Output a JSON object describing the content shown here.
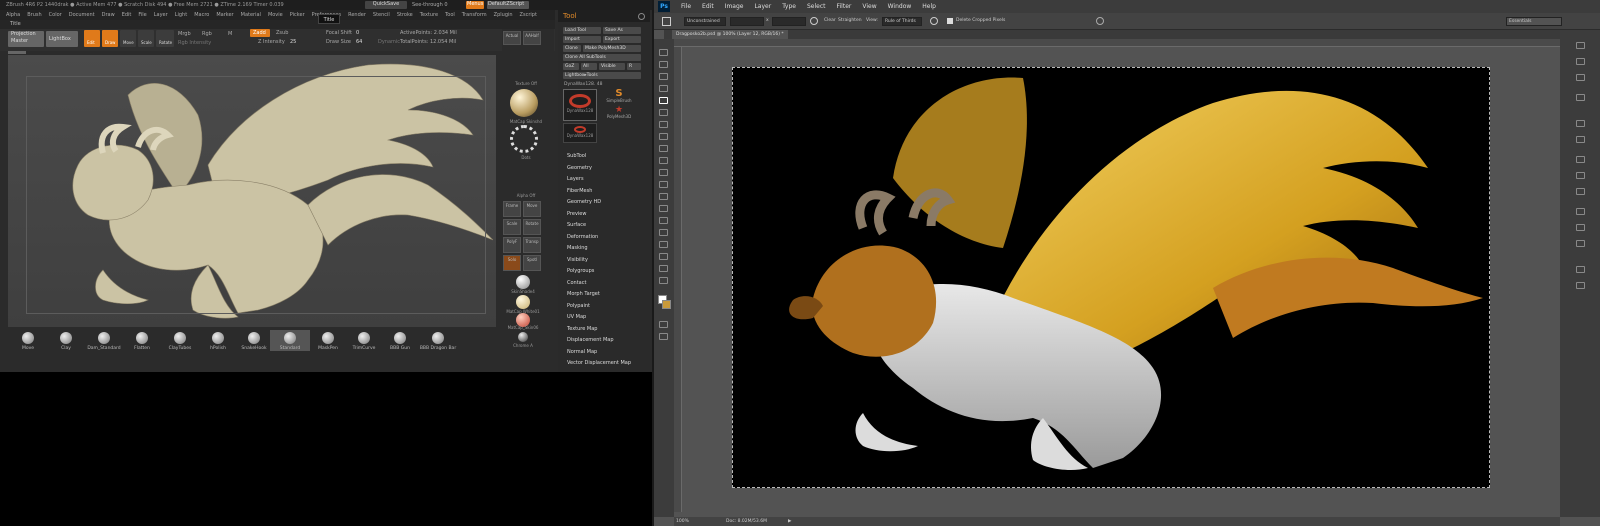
{
  "zbrush": {
    "title_bar": "ZBrush 4R6 P2   1440drak   ● Active Mem 477 ● Scratch Disk 494 ● Free Mem 2721 ● ZTime 2.169 Timer 0.039",
    "quicksave": "QuickSave",
    "see_through": "See-through 0",
    "menus_label": "Menus",
    "script_label": "DefaultZScript",
    "menu": [
      "Alpha",
      "Brush",
      "Color",
      "Document",
      "Draw",
      "Edit",
      "File",
      "Layer",
      "Light",
      "Macro",
      "Marker",
      "Material",
      "Movie",
      "Picker",
      "Preferences",
      "Render",
      "Stencil",
      "Stroke",
      "Texture",
      "Tool",
      "Transform",
      "Zplugin",
      "Zscript"
    ],
    "title_label": "Title",
    "title_tooltip": "Title",
    "shelf": {
      "projection_master": "Projection Master",
      "lightbox": "LightBox",
      "edit": "Edit",
      "draw": "Draw",
      "move": "Move",
      "scale": "Scale",
      "rotate": "Rotate",
      "mrgb": "Mrgb",
      "rgb": "Rgb",
      "m": "M",
      "rgb_intensity": "Rgb Intensity",
      "zadd": "Zadd",
      "zsub": "Zsub",
      "z_intensity_label": "Z Intensity",
      "z_intensity_value": "25",
      "focal_shift_label": "Focal Shift",
      "focal_shift_value": "0",
      "draw_size_label": "Draw Size",
      "draw_size_value": "64",
      "dynamic": "Dynamic",
      "active_points": "ActivePoints: 2.034 Mil",
      "total_points": "TotalPoints: 12.054 Mil"
    },
    "right_shelf": {
      "actual": "Actual",
      "aahalf": "AAHalf",
      "texture_off": "Texture Off",
      "matcap_label": "MatCap Skinshd",
      "dots_label": "Dots",
      "alpha_off": "Alpha Off",
      "buttons": [
        "Frame",
        "Move",
        "Scale",
        "Rotate",
        "PolyF",
        "Transp",
        "Solo",
        "Spotl"
      ],
      "skin_shade": "SkinShade4",
      "matcap_white": "MatCap White01",
      "matcap_skin": "MatCap_Skin06",
      "chrome": "Chrome A"
    },
    "brushes": [
      "Move",
      "Clay",
      "Dam_Standard",
      "Flatten",
      "ClayTubes",
      "hPolish",
      "SnakeHook",
      "Standard",
      "MaskPen",
      "TrimCurve",
      "BBB Gun",
      "BBB Dragon Bar"
    ],
    "tool": {
      "header": "Tool",
      "load_tool": "Load Tool",
      "save_as": "Save As",
      "import": "Import",
      "export": "Export",
      "clone": "Clone",
      "make_polymesh": "Make PolyMesh3D",
      "clone_all": "Clone All SubTools",
      "goz": "GoZ",
      "all": "All",
      "visible": "Visible",
      "r": "R",
      "lightbox_tools": "Lightbox▸Tools",
      "current_tool": "DynaWax128. 48",
      "thumb1": "DynaWax128",
      "thumb2": "SimpleBrush",
      "thumb3": "PolyMesh3D",
      "thumb4": "DynaWax128",
      "sections": [
        "SubTool",
        "Geometry",
        "Layers",
        "FiberMesh",
        "Geometry HD",
        "Preview",
        "Surface",
        "Deformation",
        "Masking",
        "Visibility",
        "Polygroups",
        "Contact",
        "Morph Target",
        "Polypaint",
        "UV Map",
        "Texture Map",
        "Displacement Map",
        "Normal Map",
        "Vector Displacement Map"
      ]
    }
  },
  "photoshop": {
    "logo": "Ps",
    "menu": [
      "File",
      "Edit",
      "Image",
      "Layer",
      "Type",
      "Select",
      "Filter",
      "View",
      "Window",
      "Help"
    ],
    "options": {
      "ratio": "Unconstrained",
      "x": "x",
      "clear": "Clear",
      "straighten": "Straighten",
      "view_label": "View:",
      "view_value": "Rule of Thirds",
      "delete_cropped": "Delete Cropped Pixels",
      "workspace": "Essentials"
    },
    "doc_tab": "Dragposko2b.psd @ 100% (Layer 12, RGB/16) *",
    "status_zoom": "100%",
    "status_doc": "Doc: 8.02M/53.6M"
  }
}
